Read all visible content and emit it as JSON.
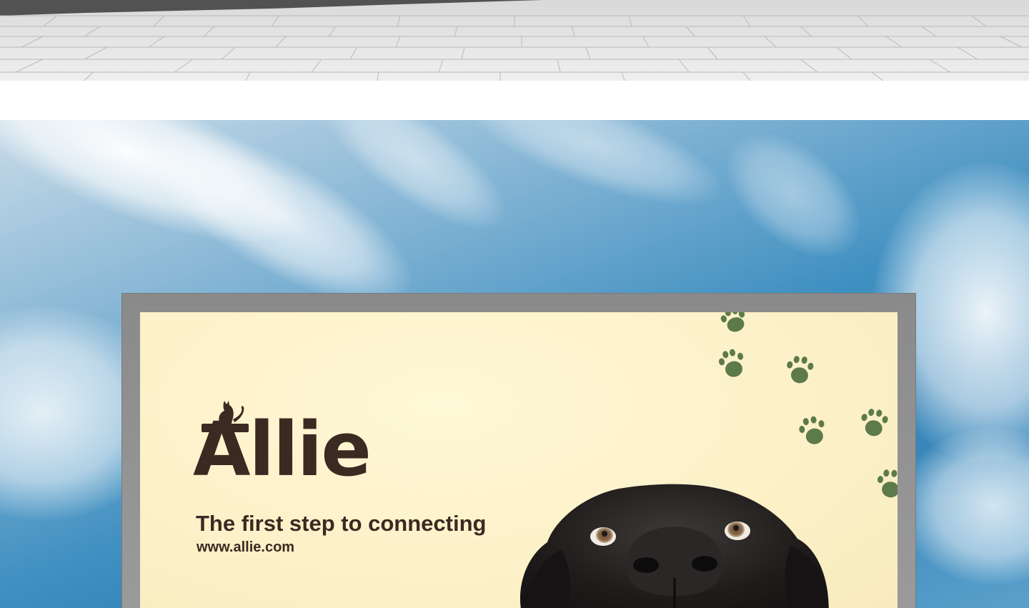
{
  "billboard": {
    "brand_name": "Allie",
    "tagline": "The first step to connecting",
    "url": "www.allie.com"
  },
  "colors": {
    "brand_text": "#3a2a22",
    "paw_prints": "#5d7a4a",
    "billboard_background": "#fcf1c8",
    "frame": "#8f8f8f",
    "sky": "#3f8fc1"
  },
  "icons": [
    "cat-logo-icon",
    "paw-print-icon",
    "dog-image"
  ]
}
